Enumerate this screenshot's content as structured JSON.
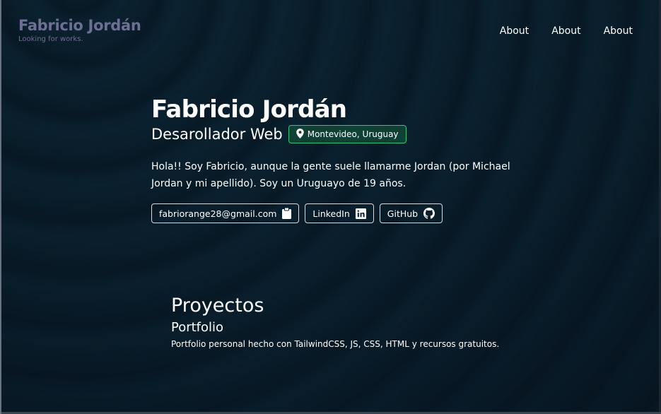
{
  "header": {
    "brand_name": "Fabricio Jordán",
    "brand_tagline": "Looking for works.",
    "nav": [
      "About",
      "About",
      "About"
    ]
  },
  "hero": {
    "name": "Fabricio Jordán",
    "role": "Desarollador Web",
    "location": "Montevideo, Uruguay",
    "bio": "Hola!! Soy Fabricio, aunque la gente suele llamarme Jordan (por Michael Jordan y mi apellido). Soy un Uruguayo de 19 años.",
    "links": {
      "email": "fabriorange28@gmail.com",
      "linkedin": "LinkedIn",
      "github": "GitHub"
    }
  },
  "projects": {
    "title": "Proyectos",
    "items": [
      {
        "name": "Portfolio",
        "description": "Portfolio personal hecho con TailwindCSS, JS, CSS, HTML y recursos gratuitos."
      }
    ]
  },
  "colors": {
    "brand": "#6e6f94",
    "location_border": "#34c47a",
    "background": "#0b2231"
  },
  "icons": {
    "location": "map-pin-icon",
    "email": "clipboard-icon",
    "linkedin": "linkedin-icon",
    "github": "github-icon"
  }
}
